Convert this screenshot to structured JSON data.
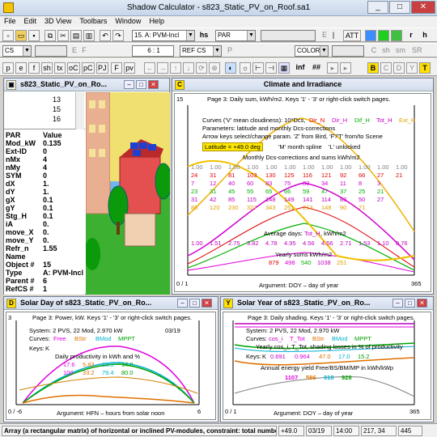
{
  "window": {
    "title": "Shadow Calculator - s823_Static_PV_on_Roof.sa1"
  },
  "menu": [
    "File",
    "Edit",
    "3D View",
    "Toolbars",
    "Window",
    "Help"
  ],
  "toolbar1": {
    "object_select": "15. A: PVM-Incl",
    "hs": "hs",
    "par_select": "PAR",
    "e": "E",
    "att": "ATT",
    "r": "r",
    "h": "h"
  },
  "toolbar2": {
    "cs": "CS",
    "e": "E",
    "f": "F",
    "scale": "6 : 1",
    "refcs": "REF CS",
    "p": "P",
    "color": "COLOR",
    "c": "C",
    "sh": "sh",
    "sm": "sm",
    "sr": "SR"
  },
  "toolbar3": {
    "buttons": [
      "p",
      "e",
      "f",
      "sh",
      "tx",
      "oC",
      "pC",
      "PJ",
      "F",
      "pv"
    ],
    "inf": "inf",
    "hash": "##",
    "colors": [
      "B",
      "C",
      "D",
      "Y",
      "T"
    ]
  },
  "objwin": {
    "title": "s823_Static_PV_on_Ro...",
    "tree": [
      "13",
      "15",
      "16"
    ],
    "headers": [
      "PAR",
      "Value"
    ],
    "rows": [
      [
        "Mod_kW",
        "0.135"
      ],
      [
        "Ext-ID",
        "0"
      ],
      [
        "nMx",
        "4"
      ],
      [
        "nMy",
        "4"
      ],
      [
        "SYM",
        "0"
      ],
      [
        "dX",
        "1."
      ],
      [
        "dY",
        "1."
      ],
      [
        "gX",
        "0.1"
      ],
      [
        "gY",
        "0.1"
      ],
      [
        "Stg_H",
        "0.1"
      ],
      [
        "iA",
        "0."
      ],
      [
        "move_X",
        "0."
      ],
      [
        "move_Y",
        "0."
      ],
      [
        "Refr_n",
        "1.55"
      ],
      [
        "Name",
        ""
      ],
      [
        "Object #",
        "15"
      ],
      [
        "Type",
        "A: PVM-Incl"
      ],
      [
        "Parent #",
        "6"
      ],
      [
        "RefCS #",
        "1"
      ]
    ]
  },
  "climate": {
    "icon": "C",
    "title": "Climate and Irradiance",
    "header": "Page 3: Daily sum, kWh/m2. Keys '1' - '3' or right-click switch pages.",
    "ytop": "15",
    "ybottom": "0 / 1",
    "xright": "365",
    "curves_label": "Curves ('V' mean cloudiness): 10*Dcs,",
    "curves": [
      "Dir_N",
      "Dir_H",
      "Dif_H",
      "Tot_H",
      "Ext_H"
    ],
    "line2": "Parameters: latitude and monthly Dcs-corrections",
    "line3": "Arrow keys select/change param. 'Z' from Bird, 'F'/'T' from/to Scene",
    "latitude": "Latitude = +49.0 deg",
    "month_spline": "'M' month spline",
    "unlocked": "'L' unlocked",
    "table_title": "Monthly Dcs-corrections and sums kWh/m2",
    "table": [
      [
        "1.00",
        "1.00",
        "1.00",
        "1.00",
        "1.00",
        "1.00",
        "1.00",
        "1.00",
        "1.00",
        "1.00",
        "1.00",
        "1.00"
      ],
      [
        "24",
        "31",
        "81",
        "103",
        "130",
        "125",
        "116",
        "121",
        "92",
        "66",
        "27",
        "21"
      ],
      [
        "7",
        "12",
        "40",
        "60",
        "83",
        "75",
        "83",
        "34",
        "11",
        "8",
        "3",
        "",
        ""
      ],
      [
        "23",
        "31",
        "45",
        "55",
        "65",
        "66",
        "59",
        "47",
        "37",
        "25",
        "21",
        "",
        ""
      ],
      [
        "31",
        "42",
        "85",
        "115",
        "148",
        "149",
        "141",
        "114",
        "83",
        "50",
        "27",
        "",
        ""
      ],
      [
        "86",
        "120",
        "230",
        "327",
        "343",
        "251",
        "213",
        "148",
        "90",
        "71",
        "",
        ""
      ]
    ],
    "avg_days": "Average days:",
    "avg_tot": "Tot_H",
    "avg_units": ", kWh/m2",
    "avg_row": [
      "1.00",
      "1.51",
      "2.75",
      "3.82",
      "4.78",
      "4.95",
      "4.56",
      "4.56",
      "2.71",
      "1.53",
      "1.10",
      "0.76"
    ],
    "yearly_label": "Yearly sums kWh/m2",
    "yearly_row": [
      "879",
      "498",
      "540",
      "1038",
      "251"
    ],
    "xaxis": "Argument: DOY – day of year"
  },
  "solarday": {
    "icon": "D",
    "title": "Solar Day of s823_Static_PV_on_Ro...",
    "header": "Page 3: Power, kW. Keys '1' - '3' or right-click switch pages.",
    "ytop": "3",
    "ybottom": "0 / -6",
    "xright": "6",
    "date": "03/19",
    "system": "System: 2 PVS, 22 Mod, 2.970 kW",
    "curves_label": "Curves:",
    "curves": [
      "Free",
      "BStr",
      "BMod",
      "MPPT"
    ],
    "keys": "Keys:",
    "keys_val": "K",
    "prod_label": "Daily productivity in kWh and %",
    "prod_row1": [
      "17.6",
      "5.83",
      "13.9",
      "14.0"
    ],
    "prod_row2": [
      "100",
      "33.2",
      "79.4",
      "80.0"
    ],
    "xaxis": "Argument: HFN – hours from solar noon"
  },
  "solaryear": {
    "icon": "Y",
    "title": "Solar Year of s823_Static_PV_on_Ro...",
    "header": "Page 3: Daily shading. Keys '1' - '3' or right-click switch pages.",
    "ytop": "",
    "ybottom": "0 / 1",
    "xright": "365",
    "system": "System: 2 PVS, 22 Mod, 2.970 kW",
    "curves_label": "Curves:",
    "curves": [
      "cos_i",
      "T_Tot",
      "BStr",
      "BMod",
      "MPPT"
    ],
    "line3": "Yearly cos_i, T_Tot, shading losses in % of productivity",
    "keys": "Keys:",
    "keys_val": "K",
    "keys_row": [
      "0.691",
      "0.964",
      "47.0",
      "17.0",
      "15.2"
    ],
    "annual_label": "Annual energy yield Free/BS/BM/MP in kWh/kWp",
    "annual_row": [
      "1107",
      "586",
      "918",
      "928"
    ],
    "xaxis": "Argument: DOY – day of year"
  },
  "status": {
    "msg": "Array (a rectangular matrix) of horizontal or inclined PV-modules, constraint: total number of modu",
    "lat": "+49.0",
    "date": "03/19",
    "time": "14:00",
    "coords": "217, 34",
    "n": "445"
  },
  "colors": {
    "dirn": "#e00000",
    "dirh": "#d000d0",
    "difh": "#00b000",
    "toth": "#c000c0",
    "exth": "#e0a000",
    "free": "#e000e0",
    "bstr": "#e07000",
    "bmod": "#00b0d0",
    "mppt": "#00a000"
  }
}
